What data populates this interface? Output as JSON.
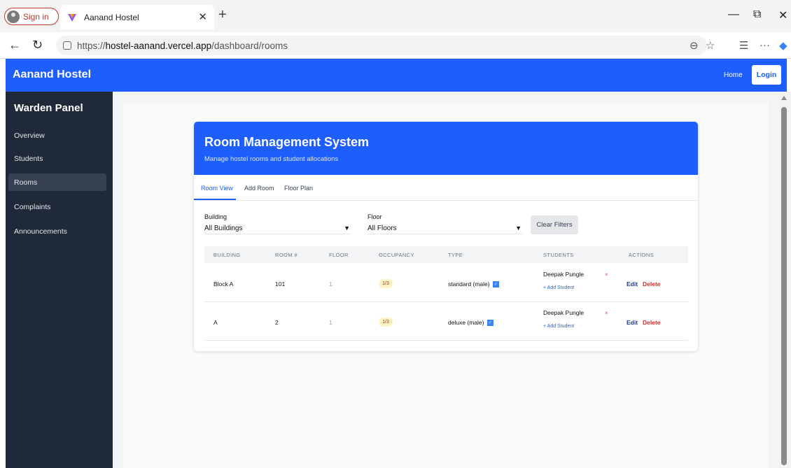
{
  "browser": {
    "signin_label": "Sign in",
    "tab_title": "Aanand Hostel",
    "url_prefix": "https://",
    "url_host": "hostel-aanand.vercel.app",
    "url_path": "/dashboard/rooms"
  },
  "header": {
    "brand": "Aanand Hostel",
    "home": "Home",
    "login": "Login"
  },
  "sidebar": {
    "title": "Warden Panel",
    "items": [
      {
        "label": "Overview"
      },
      {
        "label": "Students"
      },
      {
        "label": "Rooms"
      },
      {
        "label": "Complaints"
      },
      {
        "label": "Announcements"
      }
    ]
  },
  "card": {
    "title": "Room Management System",
    "subtitle": "Manage hostel rooms and student allocations",
    "tabs": [
      {
        "label": "Room View"
      },
      {
        "label": "Add Room"
      },
      {
        "label": "Floor Plan"
      }
    ]
  },
  "filters": {
    "building_label": "Building",
    "building_value": "All Buildings",
    "floor_label": "Floor",
    "floor_value": "All Floors",
    "clear": "Clear Filters"
  },
  "table": {
    "headers": [
      "BUILDING",
      "ROOM #",
      "FLOOR",
      "OCCUPANCY",
      "TYPE",
      "STUDENTS",
      "ACTIONS"
    ],
    "rows": [
      {
        "building": "Block A",
        "room": "101",
        "floor": "1",
        "occupancy": "1/3",
        "type": "standard (male)",
        "type_icon": "♂",
        "student": "Deepak Pungle",
        "remove": "×",
        "add": "+ Add Student",
        "edit": "Edit",
        "delete": "Delete"
      },
      {
        "building": "A",
        "room": "2",
        "floor": "1",
        "occupancy": "1/3",
        "type": "deluxe (male)",
        "type_icon": "♂",
        "student": "Deepak Pungle",
        "remove": "×",
        "add": "+ Add Student",
        "edit": "Edit",
        "delete": "Delete"
      }
    ]
  },
  "colors": {
    "primary": "#1d5efc",
    "sidebar_bg": "#1f2937",
    "delete": "#dc2626",
    "edit": "#1e3a8a"
  }
}
